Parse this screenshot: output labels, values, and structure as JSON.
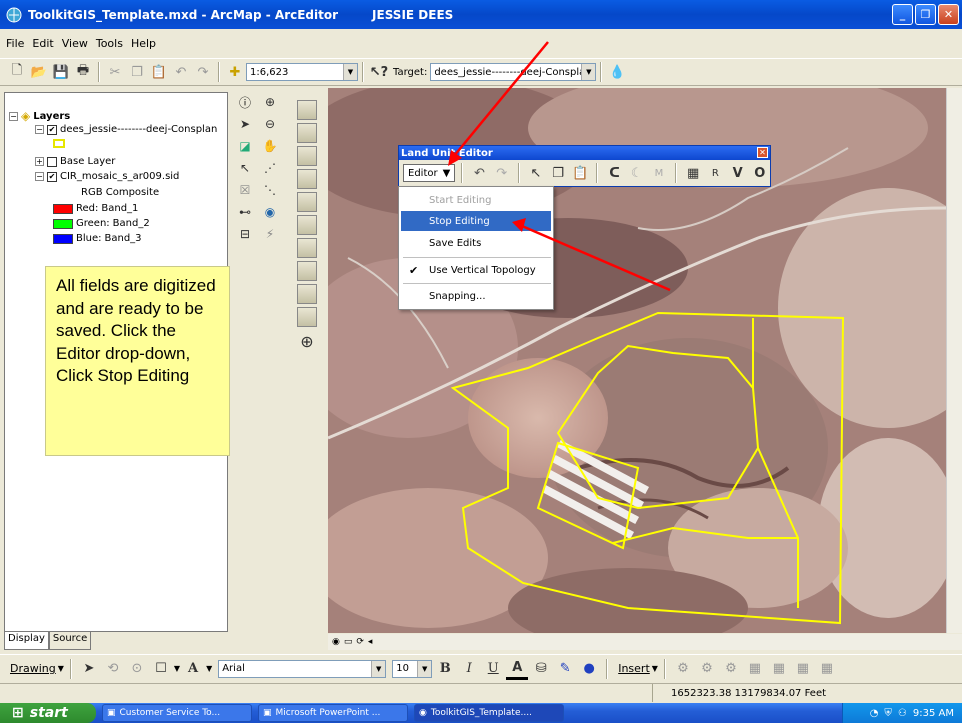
{
  "window": {
    "title": "ToolkitGIS_Template.mxd - ArcMap - ArcEditor",
    "user": "JESSIE DEES"
  },
  "menu": [
    "File",
    "Edit",
    "View",
    "Tools",
    "Help"
  ],
  "toolbar": {
    "scale": "1:6,623",
    "target_label": "Target:",
    "target_value": "dees_jessie--------deej-Consplan"
  },
  "toc": {
    "root": "Layers",
    "layers": [
      {
        "name": "dees_jessie--------deej-Consplan",
        "checked": true
      },
      {
        "name": "Base Layer",
        "checked": false
      },
      {
        "name": "CIR_mosaic_s_ar009.sid",
        "checked": true
      }
    ],
    "composite": "RGB Composite",
    "bands": [
      {
        "label": "Red:",
        "value": "Band_1",
        "color": "#ff0000"
      },
      {
        "label": "Green:",
        "value": "Band_2",
        "color": "#00ff00"
      },
      {
        "label": "Blue:",
        "value": "Band_3",
        "color": "#0000ff"
      }
    ],
    "tabs": [
      "Display",
      "Source"
    ]
  },
  "callout": "All fields are digitized and are ready to be saved. Click the Editor drop-down, Click Stop Editing",
  "editor": {
    "title": "Land Unit Editor",
    "button": "Editor",
    "menu": [
      {
        "label": "Start Editing",
        "state": "disabled"
      },
      {
        "label": "Stop Editing",
        "state": "selected"
      },
      {
        "label": "Save Edits",
        "state": "normal"
      },
      {
        "label": "Use Vertical Topology",
        "state": "checked"
      },
      {
        "label": "Snapping...",
        "state": "normal"
      }
    ],
    "tool_letters": [
      "R",
      "V",
      "O"
    ],
    "m_letter": "M"
  },
  "drawing": {
    "label": "Drawing",
    "font": "Arial",
    "size": "10",
    "insert": "Insert"
  },
  "status": {
    "coords": "1652323.38  13179834.07 Feet"
  },
  "taskbar": {
    "start": "start",
    "tasks": [
      "Customer Service To...",
      "Microsoft PowerPoint ...",
      "ToolkitGIS_Template...."
    ],
    "clock": "9:35 AM"
  },
  "colors": {
    "accent": "#316ac5",
    "callout": "#ffff99",
    "polygon": "#ffff00",
    "annotation_arrow": "#ff0000"
  }
}
